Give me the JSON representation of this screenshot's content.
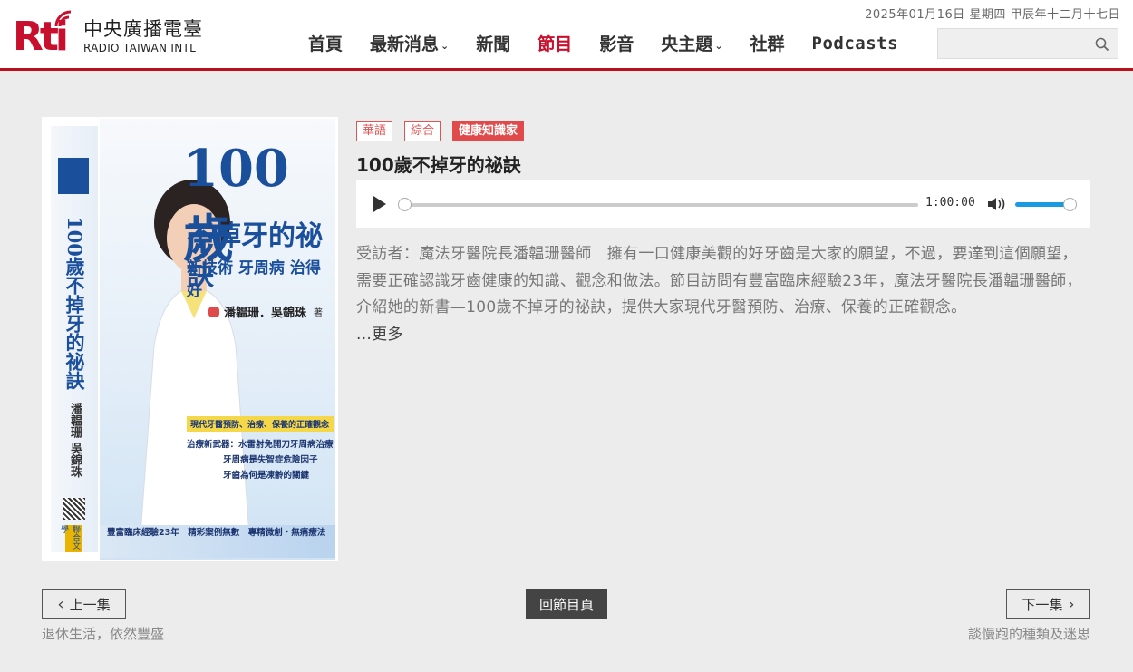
{
  "header": {
    "date": "2025年01月16日  星期四  甲辰年十二月十七日",
    "logo_cn": "中央廣播電臺",
    "logo_en": "RADIO TAIWAN INTL",
    "logo_mark": "Rti"
  },
  "nav": {
    "items": [
      {
        "label": "首頁"
      },
      {
        "label": "最新消息",
        "caret": "⌄"
      },
      {
        "label": "新聞"
      },
      {
        "label": "節目",
        "active": true
      },
      {
        "label": "影音"
      },
      {
        "label": "央主題",
        "caret": "⌄"
      },
      {
        "label": "社群"
      },
      {
        "label": "Podcasts"
      }
    ]
  },
  "search": {
    "placeholder": ""
  },
  "episode": {
    "tags": [
      "華語",
      "綜合",
      "健康知識家"
    ],
    "title": "100歲不掉牙的祕訣",
    "player": {
      "time": "1:00:00",
      "progress": 0,
      "volume": 1.0
    },
    "description": "受訪者：魔法牙醫院長潘韞珊醫師　擁有一口健康美觀的好牙齒是大家的願望，不過，要達到這個願望，需要正確認識牙齒健康的知識、觀念和做法。節目訪問有豐富臨床經驗23年，魔法牙醫院長潘韞珊醫師，介紹她的新書—100歲不掉牙的祕訣，提供大家現代牙醫預防、治療、保養的正確觀念。",
    "more": "...更多"
  },
  "cover": {
    "main_title": "100歲",
    "sub_title": "不掉牙的祕訣",
    "tagline": "新技術 牙周病 治得好",
    "authors": "潘韞珊．吳錦珠",
    "author_suffix": "著",
    "spine_title": "100歲不掉牙的祕訣",
    "spine_authors": "潘韞珊 吳錦珠",
    "spine_publisher": "聯合文學",
    "box_title": "現代牙醫預防、治療、保養的正確觀念",
    "box_lines": [
      "治療新武器：水雷射免開刀牙周病治療",
      "牙周病是失智症危險因子",
      "牙齒為何是凍齡的關鍵"
    ],
    "footer": "豐富臨床經驗23年　精彩案例無數　專精微創・無痛療法",
    "badge": "聯合文學"
  },
  "pager": {
    "prev_label": "上一集",
    "prev_title": "退休生活，依然豐盛",
    "back_label": "回節目頁",
    "next_label": "下一集",
    "next_title": "談慢跑的種類及迷思"
  },
  "colors": {
    "brand_red": "#c8102e",
    "tag_red": "#e04a4a",
    "volume_blue": "#1a9ae0"
  }
}
